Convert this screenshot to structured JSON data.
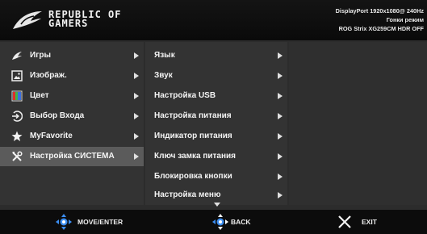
{
  "header": {
    "brand_line1": "REPUBLIC OF",
    "brand_line2": "GAMERS",
    "status_line1": "DisplayPort 1920x1080@ 240Hz",
    "status_line2": "Гонки режим",
    "status_line3": "ROG Strix XG259CM HDR OFF"
  },
  "main_menu": [
    {
      "label": "Игры",
      "icon": "rog-eye-icon",
      "selected": false
    },
    {
      "label": "Изображ.",
      "icon": "image-icon",
      "selected": false
    },
    {
      "label": "Цвет",
      "icon": "color-bars-icon",
      "selected": false
    },
    {
      "label": "Выбор Входа",
      "icon": "input-icon",
      "selected": false
    },
    {
      "label": "MyFavorite",
      "icon": "star-icon",
      "selected": false
    },
    {
      "label": "Настройка СИСТЕМА",
      "icon": "tools-icon",
      "selected": true
    }
  ],
  "sub_menu": [
    {
      "label": "Язык"
    },
    {
      "label": "Звук"
    },
    {
      "label": "Настройка USB"
    },
    {
      "label": "Настройка питания"
    },
    {
      "label": "Индикатор питания"
    },
    {
      "label": "Ключ замка питания"
    },
    {
      "label": "Блокировка кнопки"
    },
    {
      "label": "Настройка меню"
    }
  ],
  "footer": {
    "move_label": "MOVE/ENTER",
    "back_label": "BACK",
    "exit_label": "EXIT"
  },
  "colors": {
    "accent_blue": "#3b8df0",
    "selected_bg": "#5b5b5b",
    "panel_bg": "#333333"
  }
}
